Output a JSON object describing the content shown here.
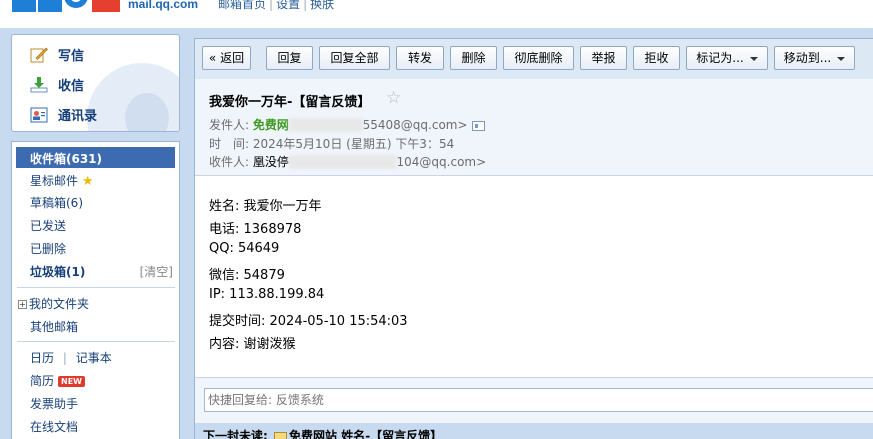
{
  "header": {
    "logo_domain": "mail.qq.com",
    "links": [
      "邮箱首页",
      "设置",
      "换肤"
    ],
    "link_separator": "|"
  },
  "quick_actions": [
    {
      "label": "写信",
      "icon": "compose-icon"
    },
    {
      "label": "收信",
      "icon": "receive-icon"
    },
    {
      "label": "通讯录",
      "icon": "contacts-icon"
    }
  ],
  "folders": {
    "inbox": "收件箱(631)",
    "starred": "星标邮件",
    "drafts": "草稿箱(6)",
    "sent": "已发送",
    "deleted": "已删除",
    "spam": "垃圾箱(1)",
    "spam_clear": "[清空]",
    "my_folders": "我的文件夹",
    "other_mailbox": "其他邮箱",
    "calendar": "日历",
    "notes": "记事本",
    "calendar_separator": "|",
    "resume": "简历",
    "new_badge": "NEW",
    "invoice": "发票助手",
    "docs": "在线文档"
  },
  "toolbar": {
    "back": "« 返回",
    "reply": "回复",
    "reply_all": "回复全部",
    "forward": "转发",
    "delete": "删除",
    "delete_permanent": "彻底删除",
    "report": "举报",
    "reject": "拒收",
    "mark_as": "标记为...",
    "move_to": "移动到..."
  },
  "mail": {
    "subject": "我爱你一万年-【留言反馈】",
    "from_label": "发件人:",
    "from_name": "免费网",
    "from_addr": "55408@qq.com>",
    "time_label": "时　间:",
    "time_value": "2024年5月10日 (星期五) 下午3：54",
    "to_label": "收件人:",
    "to_name": "凰没停",
    "to_addr": "104@qq.com>",
    "body": [
      "姓名: 我爱你一万年",
      "电话: 1368978",
      "QQ: 54649",
      "微信: 54879",
      "IP: 113.88.199.84",
      "提交时间: 2024-05-10 15:54:03",
      "内容: 谢谢泼猴"
    ]
  },
  "reply": {
    "placeholder": "快捷回复给: 反馈系统"
  },
  "next_mail": {
    "label": "下一封未读:",
    "sender": "免费网站",
    "subject": "姓名-【留言反馈】"
  },
  "colors": {
    "brand_blue": "#1e64b4",
    "selection": "#3d6bb1",
    "frame": "#c8daef",
    "sender_green": "#3f9a23",
    "badge_red": "#e03a2f"
  }
}
